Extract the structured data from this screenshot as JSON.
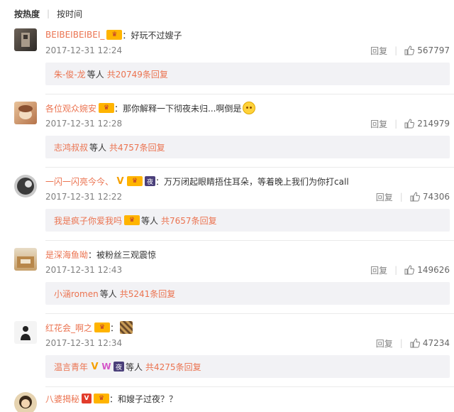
{
  "sort": {
    "hot": "按热度",
    "time": "按时间"
  },
  "comments": [
    {
      "user": "BEIBEIBEIBEI_",
      "colon": "：",
      "text": "好玩不过嫂子",
      "time": "2017-12-31 12:24",
      "reply": "回复",
      "likes": "567797",
      "replies_names": "朱-俊-龙",
      "replies_mid": "等人",
      "replies_count": "共20749条回复"
    },
    {
      "user": "各位观众婉安",
      "colon": "：",
      "text": "那你解释一下彻夜未归...啊倒是",
      "time": "2017-12-31 12:28",
      "reply": "回复",
      "likes": "214979",
      "replies_names": "志鸿叔叔",
      "replies_mid": "等人",
      "replies_count": "共4757条回复"
    },
    {
      "user": "一闪一闪亮今今、",
      "colon": "：",
      "text": "万万闭起眼睛捂住耳朵，等着晚上我们为你打call",
      "time": "2017-12-31 12:22",
      "reply": "回复",
      "likes": "74306",
      "badge_night": "夜",
      "replies_names": "我是疯子你爱我吗",
      "replies_mid": "等人",
      "replies_count": "共7657条回复"
    },
    {
      "user": "是深海鱼呦",
      "colon": "：",
      "text": "被粉丝三观震惊",
      "time": "2017-12-31 12:43",
      "reply": "回复",
      "likes": "149626",
      "replies_names": "小涵romen",
      "replies_mid": "等人",
      "replies_count": "共5241条回复"
    },
    {
      "user": "红花会_啊之",
      "colon": "：",
      "text": "",
      "time": "2017-12-31 12:34",
      "reply": "回复",
      "likes": "47234",
      "replies_names": "温言青年",
      "replies_mid": "等人",
      "replies_count": "共4275条回复",
      "badge_night": "夜"
    },
    {
      "user": "八婆揭秘",
      "colon": "：",
      "text": "和嫂子过夜？？",
      "badge_v": "V"
    }
  ],
  "icon_names": {
    "like": "thumbs-up-icon",
    "fan": "fan-badge-icon",
    "vip": "v-verified-icon"
  },
  "colors": {
    "username": "#eb7350",
    "time": "#808080",
    "reply_bg": "#f2f2f5"
  }
}
